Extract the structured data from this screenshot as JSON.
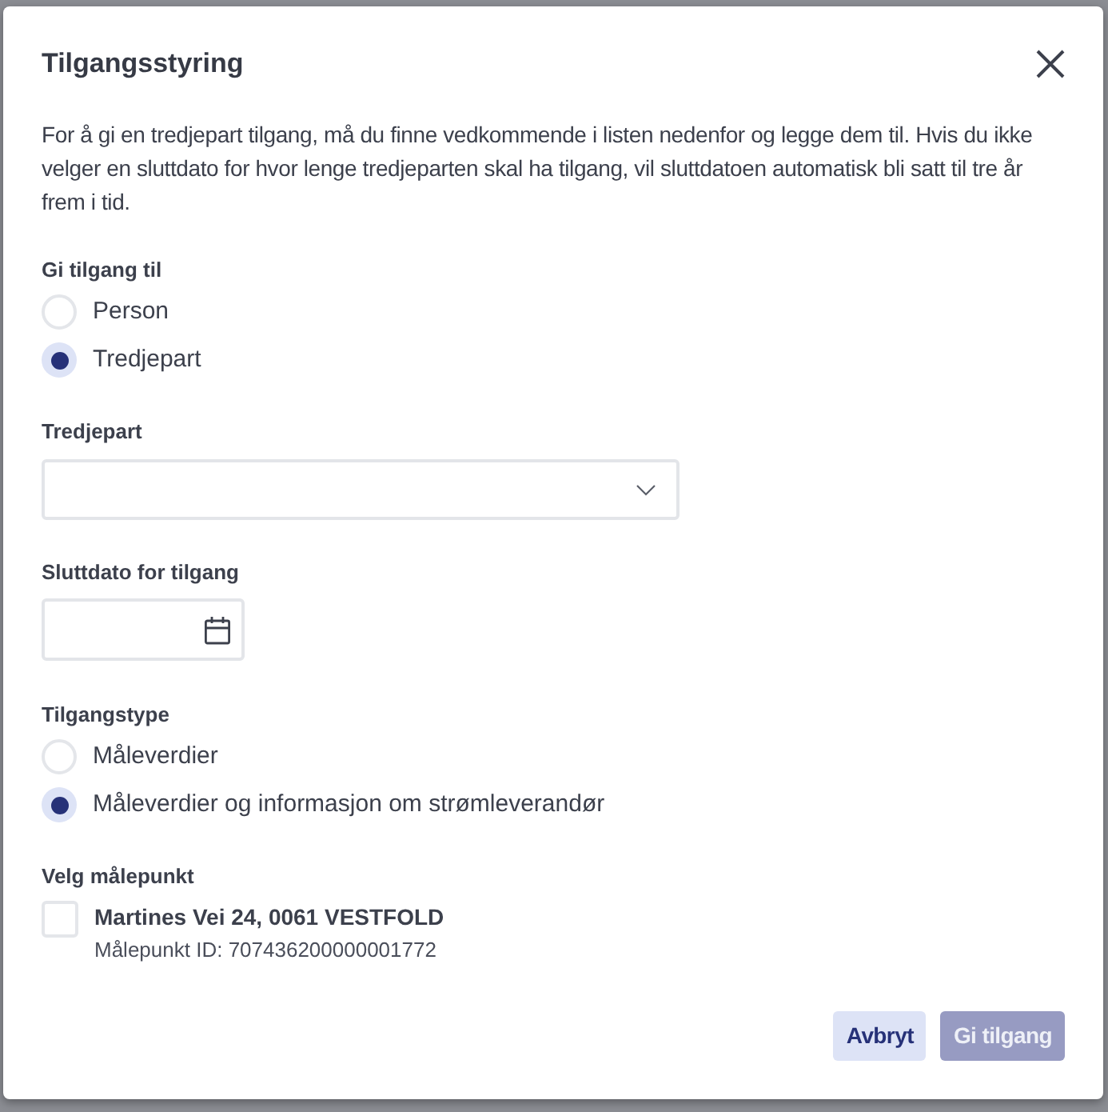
{
  "dialog": {
    "title": "Tilgangsstyring",
    "description": "For å gi en tredjepart tilgang, må du finne vedkommende i listen nedenfor og legge dem til. Hvis du ikke velger en sluttdato for hvor lenge tredjeparten skal ha tilgang, vil sluttdatoen automatisk bli satt til tre år frem i tid."
  },
  "access_to": {
    "label": "Gi tilgang til",
    "options": [
      {
        "label": "Person",
        "selected": false
      },
      {
        "label": "Tredjepart",
        "selected": true
      }
    ]
  },
  "third_party": {
    "label": "Tredjepart"
  },
  "end_date": {
    "label": "Sluttdato for tilgang"
  },
  "access_type": {
    "label": "Tilgangstype",
    "options": [
      {
        "label": "Måleverdier",
        "selected": false
      },
      {
        "label": "Måleverdier og informasjon om strømleverandør",
        "selected": true
      }
    ]
  },
  "metering_point": {
    "label": "Velg målepunkt",
    "items": [
      {
        "address": "Martines Vei 24, 0061 VESTFOLD",
        "id_text": "Målepunkt ID: 707436200000001772",
        "checked": false
      }
    ]
  },
  "buttons": [
    {
      "label": "Avbryt",
      "kind": "secondary",
      "disabled": false
    },
    {
      "label": "Gi tilgang",
      "kind": "primary",
      "disabled": true
    }
  ]
}
